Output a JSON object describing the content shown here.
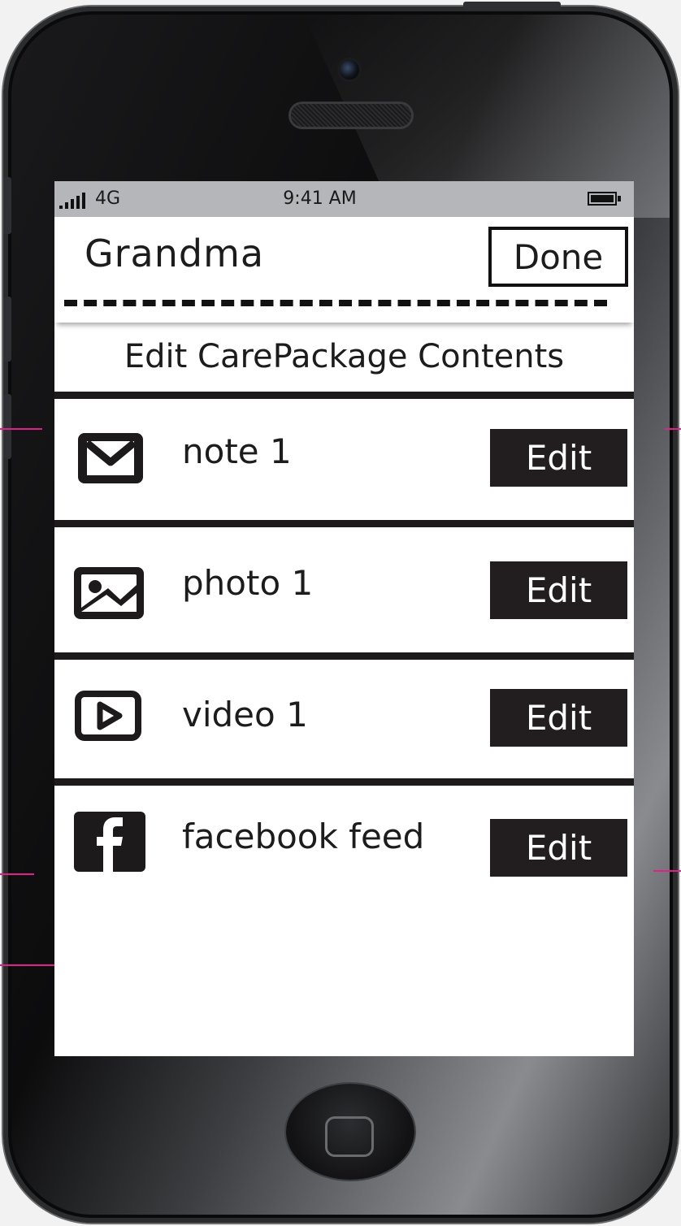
{
  "status_bar": {
    "carrier": "4G",
    "time": "9:41 AM"
  },
  "header": {
    "title": "Grandma",
    "done_label": "Done"
  },
  "section_title": "Edit CarePackage Contents",
  "items": [
    {
      "label": "note 1",
      "icon": "envelope-icon",
      "edit_label": "Edit"
    },
    {
      "label": "photo 1",
      "icon": "image-icon",
      "edit_label": "Edit"
    },
    {
      "label": "video 1",
      "icon": "play-icon",
      "edit_label": "Edit"
    },
    {
      "label": "facebook feed",
      "icon": "facebook-icon",
      "edit_label": "Edit"
    }
  ],
  "colors": {
    "annotation_line": "#e0218a",
    "button_dark": "#221e1f",
    "status_bar": "#b4b6b9"
  }
}
